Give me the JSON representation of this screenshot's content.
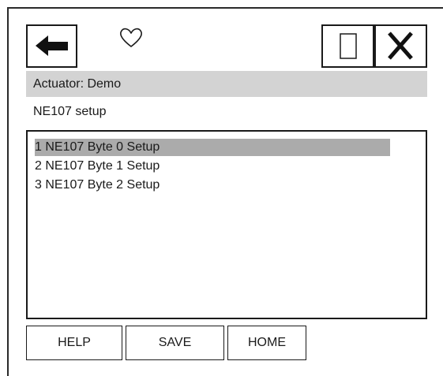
{
  "toolbar": {
    "back_icon": "arrow-left-icon",
    "favorite_icon": "heart-outline-icon",
    "window_icon": "rectangle-icon",
    "close_icon": "close-x-icon"
  },
  "header": {
    "label": "Actuator: Demo"
  },
  "page": {
    "title": "NE107 setup"
  },
  "menu": {
    "selected_index": 0,
    "items": [
      {
        "label": "1 NE107 Byte 0 Setup"
      },
      {
        "label": "2 NE107 Byte 1 Setup"
      },
      {
        "label": "3 NE107 Byte 2 Setup"
      }
    ]
  },
  "buttons": {
    "help": "HELP",
    "save": "SAVE",
    "home": "HOME"
  },
  "colors": {
    "header_bg": "#d3d3d3",
    "selected_bg": "#ababab",
    "border": "#1a1a1a"
  }
}
